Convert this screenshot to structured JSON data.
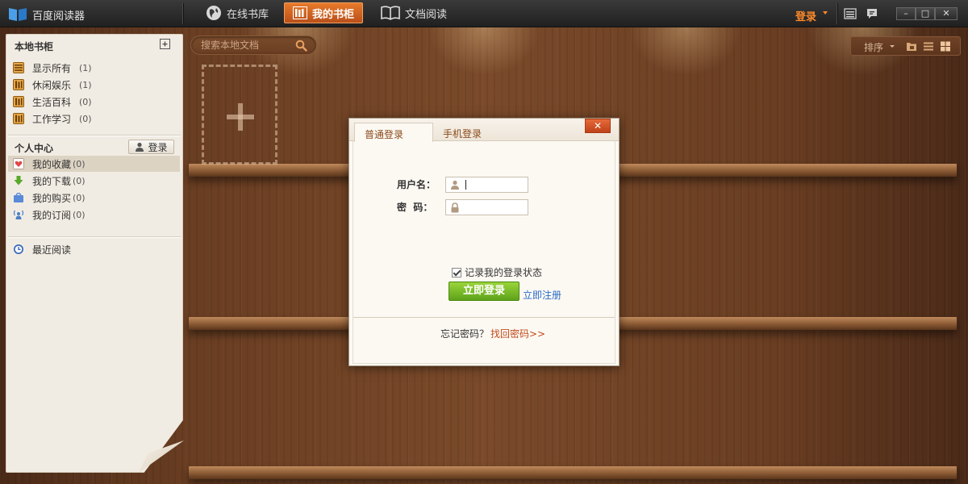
{
  "app": {
    "title": "百度阅读器"
  },
  "nav": [
    {
      "label": "在线书库",
      "icon": "globe-icon",
      "active": false
    },
    {
      "label": "我的书柜",
      "icon": "bookshelf-icon",
      "active": true
    },
    {
      "label": "文档阅读",
      "icon": "open-book-icon",
      "active": false
    }
  ],
  "topbar": {
    "login_label": "登录",
    "icons": [
      "list-icon",
      "chat-bubble-icon"
    ],
    "window_controls": {
      "minimize": "–",
      "maximize": "□",
      "close": "✕"
    }
  },
  "sidebar": {
    "local_shelf_title": "本地书柜",
    "local_items": [
      {
        "label": "显示所有",
        "count": "(1)",
        "icon": "shelf-all-icon"
      },
      {
        "label": "休闲娱乐",
        "count": "(1)",
        "icon": "shelf-category-icon"
      },
      {
        "label": "生活百科",
        "count": "(0)",
        "icon": "shelf-category-icon"
      },
      {
        "label": "工作学习",
        "count": "(0)",
        "icon": "shelf-category-icon"
      }
    ],
    "personal_title": "个人中心",
    "personal_login_label": "登录",
    "personal_items": [
      {
        "label": "我的收藏",
        "count": "(0)",
        "icon": "heart-icon",
        "selected": true
      },
      {
        "label": "我的下载",
        "count": "(0)",
        "icon": "download-arrow-icon",
        "selected": false
      },
      {
        "label": "我的购买",
        "count": "(0)",
        "icon": "shopping-bag-icon",
        "selected": false
      },
      {
        "label": "我的订阅",
        "count": "(0)",
        "icon": "subscribe-icon",
        "selected": false
      }
    ],
    "recent_label": "最近阅读"
  },
  "search": {
    "placeholder": "搜索本地文档"
  },
  "toolbar": {
    "sort_label": "排序"
  },
  "dialog": {
    "tabs": [
      "普通登录",
      "手机登录"
    ],
    "active_tab": "普通登录",
    "close_label": "✕",
    "username_label": "用户名：",
    "username_value": "",
    "password_label": "密  码：",
    "password_value": "",
    "remember_label": "记录我的登录状态",
    "remember_checked": true,
    "submit_label": "立即登录",
    "register_label": "立即注册",
    "forgot_question": "忘记密码？",
    "forgot_link": "找回密码>>"
  },
  "colors": {
    "accent_orange": "#ff8a2a",
    "active_tab": "#d8691f",
    "submit_green": "#7bc02a",
    "link_blue": "#2a6ac8",
    "close_red": "#d45028",
    "wood": "#6a3e22"
  }
}
